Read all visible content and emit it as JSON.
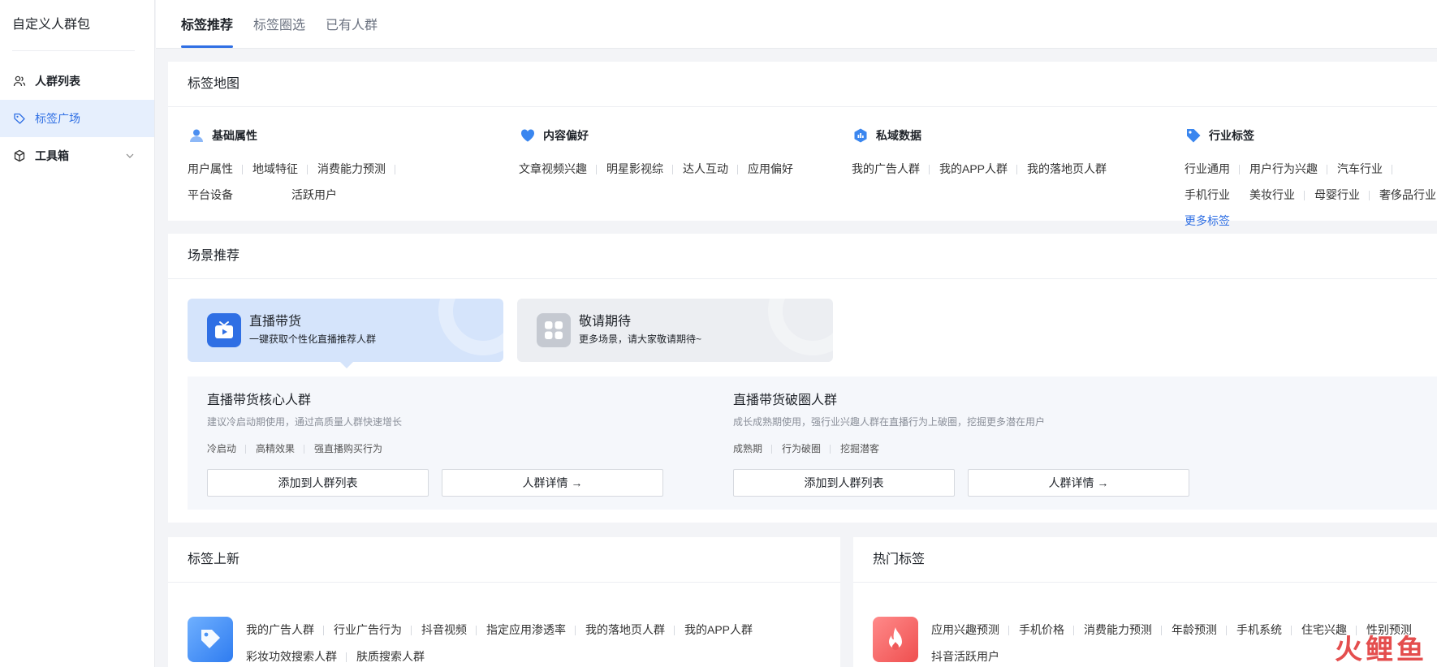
{
  "sidebar": {
    "title": "自定义人群包",
    "items": [
      {
        "label": "人群列表",
        "icon": "users-icon"
      },
      {
        "label": "标签广场",
        "icon": "tag-icon"
      },
      {
        "label": "工具箱",
        "icon": "box-icon"
      }
    ]
  },
  "tabs": [
    {
      "label": "标签推荐",
      "active": true
    },
    {
      "label": "标签圈选",
      "active": false
    },
    {
      "label": "已有人群",
      "active": false
    }
  ],
  "tag_map": {
    "title": "标签地图",
    "groups": [
      {
        "title": "基础属性",
        "icon": "user-icon",
        "tags": [
          "用户属性",
          "地域特征",
          "消费能力预测",
          "平台设备",
          "活跃用户"
        ]
      },
      {
        "title": "内容偏好",
        "icon": "heart-icon",
        "tags": [
          "文章视频兴趣",
          "明星影视综",
          "达人互动",
          "应用偏好"
        ]
      },
      {
        "title": "私域数据",
        "icon": "chart-icon",
        "tags": [
          "我的广告人群",
          "我的APP人群",
          "我的落地页人群"
        ]
      },
      {
        "title": "行业标签",
        "icon": "price-tag-icon",
        "tags": [
          "行业通用",
          "用户行为兴趣",
          "汽车行业",
          "手机行业",
          "美妆行业",
          "母婴行业",
          "奢侈品行业"
        ],
        "more": "更多标签"
      }
    ]
  },
  "scenes": {
    "title": "场景推荐",
    "cards": [
      {
        "title": "直播带货",
        "subtitle": "一键获取个性化直播推荐人群",
        "icon": "tv-play-icon"
      },
      {
        "title": "敬请期待",
        "subtitle": "更多场景，请大家敬请期待~",
        "icon": "grid-icon"
      }
    ],
    "panels": [
      {
        "title": "直播带货核心人群",
        "desc": "建议冷启动期使用，通过高质量人群快速增长",
        "tags": [
          "冷启动",
          "高精效果",
          "强直播购买行为"
        ],
        "add_label": "添加到人群列表",
        "detail_label": "人群详情 →"
      },
      {
        "title": "直播带货破圈人群",
        "desc": "成长成熟期使用，强行业兴趣人群在直播行为上破圈，挖掘更多潜在用户",
        "tags": [
          "成熟期",
          "行为破圈",
          "挖掘潜客"
        ],
        "add_label": "添加到人群列表",
        "detail_label": "人群详情 →"
      }
    ]
  },
  "new_tags": {
    "title": "标签上新",
    "icon": "tag-box-icon",
    "tags": [
      "我的广告人群",
      "行业广告行为",
      "抖音视频",
      "指定应用渗透率",
      "我的落地页人群",
      "我的APP人群",
      "彩妆功效搜索人群",
      "肤质搜索人群"
    ]
  },
  "hot_tags": {
    "title": "热门标签",
    "icon": "fire-icon",
    "tags": [
      "应用兴趣预测",
      "手机价格",
      "消费能力预测",
      "年龄预测",
      "手机系统",
      "住宅兴趣",
      "性别预测",
      "抖音活跃用户"
    ]
  },
  "watermark": "火鲤鱼",
  "colors": {
    "accent": "#2f6fe4",
    "active_bg": "#e6effd",
    "scene_active": "#d5e4fb",
    "hot": "#ef5a5a"
  }
}
